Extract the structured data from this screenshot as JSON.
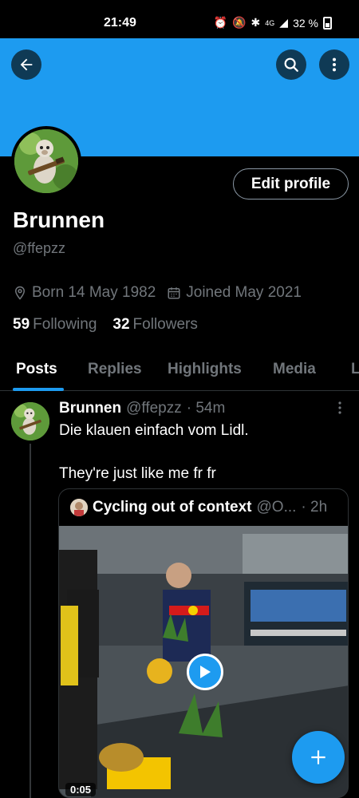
{
  "status": {
    "time": "21:49",
    "battery": "32 %",
    "network": "4G"
  },
  "header": {
    "back_icon": "arrow-left-icon",
    "search_icon": "search-icon",
    "more_icon": "more-vertical-icon",
    "banner_color": "#1d9bf0"
  },
  "profile": {
    "edit_label": "Edit profile",
    "name": "Brunnen",
    "handle": "@ffepzz",
    "born": "Born 14 May 1982",
    "joined": "Joined May 2021",
    "following_count": "59",
    "following_label": "Following",
    "followers_count": "32",
    "followers_label": "Followers"
  },
  "tabs": [
    {
      "label": "Posts",
      "active": true
    },
    {
      "label": "Replies",
      "active": false
    },
    {
      "label": "Highlights",
      "active": false
    },
    {
      "label": "Media",
      "active": false
    },
    {
      "label": "L",
      "active": false
    }
  ],
  "post": {
    "author": "Brunnen",
    "handle": "@ffepzz",
    "time": "· 54m",
    "text_line1": "Die klauen einfach vom Lidl.",
    "text_line2": "They're just like me fr fr",
    "quote": {
      "author": "Cycling out of context",
      "handle": "@O...",
      "time": "· 2h",
      "duration": "0:05"
    }
  },
  "fab": {
    "icon": "plus-icon"
  },
  "colors": {
    "accent": "#1d9bf0",
    "muted": "#71767b",
    "border": "#2f3336"
  }
}
